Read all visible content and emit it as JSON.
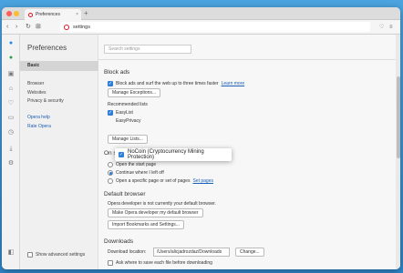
{
  "colors": {
    "accent": "#2f7fd6",
    "opera_red": "#e01020",
    "link": "#1a5fb4"
  },
  "tab": {
    "title": "Preferences",
    "close": "×",
    "new_tab": "+"
  },
  "toolbar": {
    "back": "‹",
    "forward": "›",
    "reload": "↻",
    "tabs": "⊞",
    "address": "settings",
    "heart": "♡",
    "menu": "≡"
  },
  "sidebar": {
    "icons": [
      "messenger-icon",
      "whatsapp-icon",
      "apps-icon",
      "bookmarks-icon",
      "heart-icon",
      "history-icon",
      "clock-icon",
      "downloads-icon",
      "settings-icon"
    ],
    "bottom_icon": "sidebar-toggle-icon"
  },
  "leftnav": {
    "title": "Preferences",
    "items": [
      "Basic",
      "Browser",
      "Websites",
      "Privacy & security"
    ],
    "links": [
      "Opera help",
      "Rate Opera"
    ],
    "advanced": "Show advanced settings"
  },
  "search": {
    "placeholder": "Search settings"
  },
  "block_ads": {
    "title": "Block ads",
    "checkbox_label": "Block ads and surf the web up to three times faster",
    "learn_more": "Learn more",
    "manage_exceptions": "Manage Exceptions...",
    "recommended_lists": "Recommended lists",
    "lists": [
      "EasyList",
      "EasyPrivacy"
    ],
    "nocoin": "NoCoin (Cryptocurrency Mining Protection)",
    "manage_lists": "Manage Lists..."
  },
  "on_startup": {
    "title": "On startup",
    "options": [
      "Open the start page",
      "Continue where I left off",
      "Open a specific page or set of pages"
    ],
    "set_pages": "Set pages"
  },
  "default_browser": {
    "title": "Default browser",
    "status": "Opera developer is not currently your default browser.",
    "make_default": "Make Opera developer my default browser",
    "import": "Import Bookmarks and Settings..."
  },
  "downloads": {
    "title": "Downloads",
    "location_label": "Download location:",
    "location_value": "/Users/alicjadrozdaz/Downloads",
    "change": "Change...",
    "ask_label": "Ask where to save each file before downloading"
  }
}
